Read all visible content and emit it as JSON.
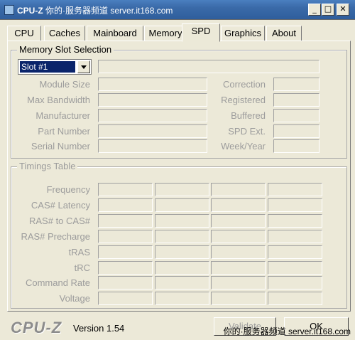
{
  "window": {
    "title_prefix": "CPU-Z",
    "title_watermark": "你的·服务器频道 server.it168.com",
    "minimize_glyph": "_",
    "maximize_glyph": "□",
    "close_glyph": "✕"
  },
  "tabs": [
    {
      "label": "CPU",
      "active": false
    },
    {
      "label": "Caches",
      "active": false
    },
    {
      "label": "Mainboard",
      "active": false
    },
    {
      "label": "Memory",
      "active": false
    },
    {
      "label": "SPD",
      "active": true
    },
    {
      "label": "Graphics",
      "active": false
    },
    {
      "label": "About",
      "active": false
    }
  ],
  "memory_slot_selection": {
    "title": "Memory Slot Selection",
    "slot_value": "Slot #1",
    "left_labels": [
      "Module Size",
      "Max Bandwidth",
      "Manufacturer",
      "Part Number",
      "Serial Number"
    ],
    "right_labels": [
      "Correction",
      "Registered",
      "Buffered",
      "SPD Ext.",
      "Week/Year"
    ]
  },
  "timings_table": {
    "title": "Timings Table",
    "row_labels": [
      "Frequency",
      "CAS# Latency",
      "RAS# to CAS#",
      "RAS# Precharge",
      "tRAS",
      "tRC",
      "Command Rate",
      "Voltage"
    ],
    "column_count": 4
  },
  "footer": {
    "logo": "CPU-Z",
    "version": "Version 1.54",
    "validate_label": "Validate",
    "ok_label": "OK",
    "watermark": "你的·服务器频道 server.it168.com"
  },
  "colors": {
    "titlebar": "#3a6aa8",
    "dialog_bg": "#ece9d8",
    "selection": "#0a246a",
    "disabled_text": "#9c9c9c"
  }
}
